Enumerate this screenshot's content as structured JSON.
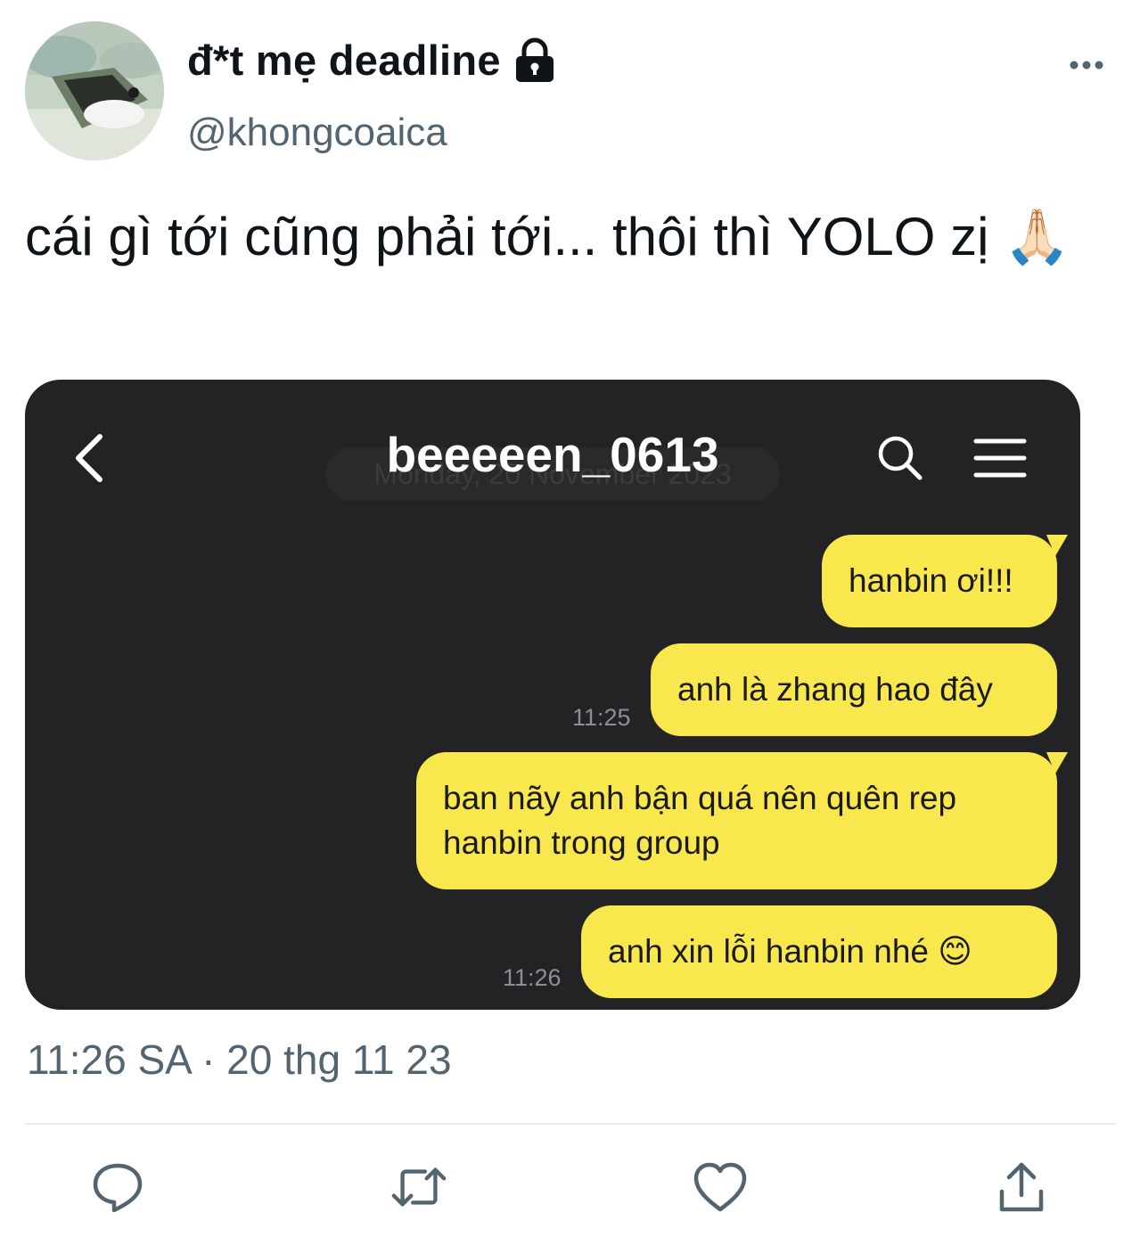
{
  "author": {
    "display_name": "đ*t mẹ deadline",
    "handle": "@khongcoaica",
    "avatar_icon": "cartoon-avatar",
    "protected_icon": "lock-icon"
  },
  "tweet": {
    "text": "cái gì tới cũng phải tới... thôi thì YOLO zị 🙏🏻",
    "timestamp": "11:26 SA · 20 thg 11 23"
  },
  "chat_screenshot": {
    "title": "beeeeen_0613",
    "date_divider": "Monday, 20 November 2023",
    "messages": [
      {
        "text": "hanbin ơi!!!",
        "time": ""
      },
      {
        "text": "anh là zhang hao đây",
        "time": "11:25"
      },
      {
        "text": "ban nãy anh bận quá nên quên rep hanbin trong group",
        "time": ""
      },
      {
        "text": "anh xin lỗi hanbin nhé 😊",
        "time": "11:26"
      }
    ],
    "colors": {
      "background": "#232325",
      "bubble": "#f8e74d",
      "title": "#ffffff"
    }
  },
  "actions": [
    "reply-icon",
    "retweet-icon",
    "like-icon",
    "share-icon"
  ],
  "colors": {
    "text": "#0f1419",
    "secondary": "#536471",
    "divider": "#e6ecf0"
  }
}
